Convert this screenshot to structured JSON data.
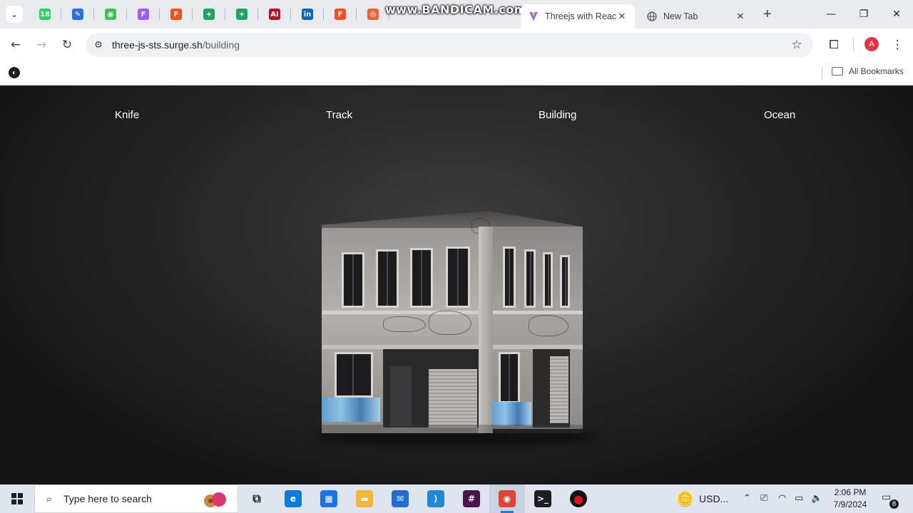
{
  "browser": {
    "watermark": "www.BANDICAM.com",
    "pinned_tabs": [
      {
        "icon": "whatsapp-icon",
        "glyph": "18",
        "color": "#25d366"
      },
      {
        "icon": "draw-app-icon",
        "glyph": "✎",
        "color": "#2b6fdc"
      },
      {
        "icon": "green-circle-app-icon",
        "glyph": "◉",
        "color": "#3fbf5a"
      },
      {
        "icon": "figma-icon",
        "glyph": "F",
        "color": "#a259ff"
      },
      {
        "icon": "figma-icon",
        "glyph": "F",
        "color": "#f24e1e"
      },
      {
        "icon": "google-sheets-icon",
        "glyph": "+",
        "color": "#1ea362"
      },
      {
        "icon": "google-sheets-icon",
        "glyph": "+",
        "color": "#1ea362"
      },
      {
        "icon": "illustrator-ai-icon",
        "glyph": "AI",
        "color": "#b3122e"
      },
      {
        "icon": "linkedin-icon",
        "glyph": "in",
        "color": "#0a66c2"
      },
      {
        "icon": "figma-icon",
        "glyph": "F",
        "color": "#f24e1e"
      },
      {
        "icon": "orange-app-icon",
        "glyph": "◎",
        "color": "#e8633a"
      }
    ],
    "tabs": [
      {
        "title": "Threejs with React",
        "active": true
      },
      {
        "title": "New Tab",
        "active": false
      }
    ],
    "url_host": "three-js-sts.surge.sh",
    "url_path": "/building",
    "profile_initial": "A",
    "all_bookmarks_label": "All Bookmarks"
  },
  "page": {
    "nav": [
      "Knife",
      "Track",
      "Building",
      "Ocean"
    ],
    "model": "building-3d-model"
  },
  "taskbar": {
    "search_placeholder": "Type here to search",
    "apps": [
      {
        "name": "task-view-icon",
        "glyph": "⧉",
        "color": "#333333"
      },
      {
        "name": "edge-icon",
        "glyph": "e",
        "color": "#0f7bd8"
      },
      {
        "name": "microsoft-store-icon",
        "glyph": "▦",
        "color": "#1a73e8"
      },
      {
        "name": "file-explorer-icon",
        "glyph": "▬",
        "color": "#f2b632"
      },
      {
        "name": "mail-icon",
        "glyph": "✉",
        "color": "#1f6fd0"
      },
      {
        "name": "vscode-icon",
        "glyph": "⟩",
        "color": "#1f8ad2"
      },
      {
        "name": "slack-icon",
        "glyph": "#",
        "color": "#4a154b"
      },
      {
        "name": "chrome-icon",
        "glyph": "◉",
        "color": "#db4437"
      },
      {
        "name": "terminal-icon",
        "glyph": ">_",
        "color": "#1e1e1e"
      },
      {
        "name": "bandicam-record-icon",
        "glyph": "●",
        "color": "#e0101a"
      }
    ],
    "tray_currency": "USD...",
    "time": "2:06 PM",
    "date": "7/9/2024",
    "notification_count": "8"
  }
}
